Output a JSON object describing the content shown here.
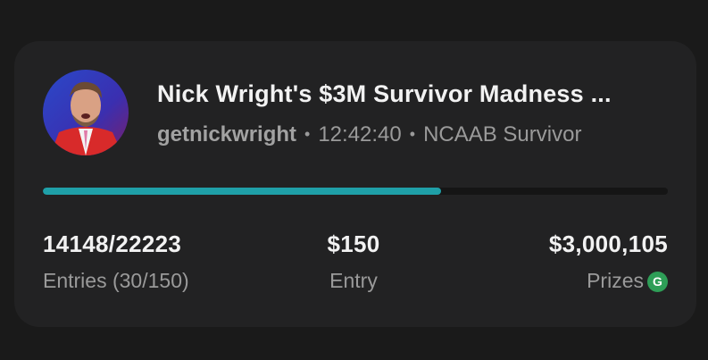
{
  "contest": {
    "title": "Nick Wright's $3M Survivor Madness ...",
    "author": "getnickwright",
    "time": "12:42:40",
    "sport": "NCAAB Survivor",
    "separator": "•",
    "progress_fraction": 0.6367
  },
  "stats": {
    "entries_value": "14148/22223",
    "entries_label": "Entries (30/150)",
    "fee_value": "$150",
    "fee_label": "Entry",
    "prizes_value": "$3,000,105",
    "prizes_label": "Prizes",
    "prizes_badge": "G"
  },
  "colors": {
    "progress": "#1fa0a8",
    "badge": "#2e9e57"
  }
}
